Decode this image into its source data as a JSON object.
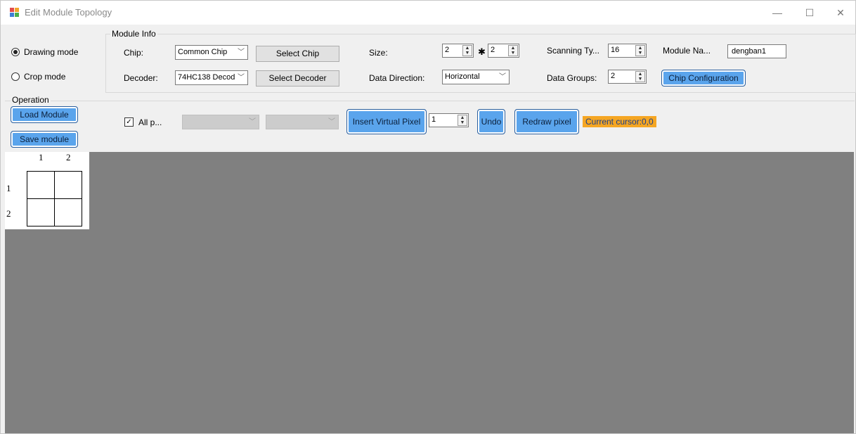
{
  "window": {
    "title": "Edit Module Topology",
    "controls": {
      "minimize": "—",
      "maximize": "☐",
      "close": "✕"
    }
  },
  "mode": {
    "drawing_label": "Drawing mode",
    "crop_label": "Crop mode",
    "selected": "drawing"
  },
  "module_info": {
    "group_title": "Module Info",
    "chip_label": "Chip:",
    "chip_value": "Common Chip",
    "select_chip": "Select Chip",
    "decoder_label": "Decoder:",
    "decoder_value": "74HC138 Decod",
    "select_decoder": "Select Decoder",
    "size_label": "Size:",
    "size_w": "2",
    "size_sep": "✱",
    "size_h": "2",
    "data_direction_label": "Data Direction:",
    "data_direction_value": "Horizontal",
    "scanning_label": "Scanning Ty...",
    "scanning_value": "16",
    "data_groups_label": "Data Groups:",
    "data_groups_value": "2",
    "module_name_label": "Module Na...",
    "module_name_value": "dengban1",
    "chip_config": "Chip Configuration"
  },
  "operation": {
    "group_title": "Operation",
    "load_module": "Load Module",
    "save_module": "Save module",
    "all_label": "All p...",
    "all_checked": true,
    "insert_virtual_pixel": "Insert Virtual Pixel",
    "virtual_count": "1",
    "undo": "Undo",
    "redraw": "Redraw pixel",
    "cursor_status": "Current cursor:0,0"
  },
  "grid": {
    "columns": [
      "1",
      "2"
    ],
    "rows": [
      "1",
      "2"
    ]
  },
  "icons": {
    "dropdown": "chevron-down-icon",
    "spinner": "spinner-arrows-icon",
    "check": "checkmark-icon"
  },
  "colors": {
    "accent_button": "#5aa4ec",
    "status_bg": "#f5a623",
    "canvas_bg": "#808080"
  }
}
